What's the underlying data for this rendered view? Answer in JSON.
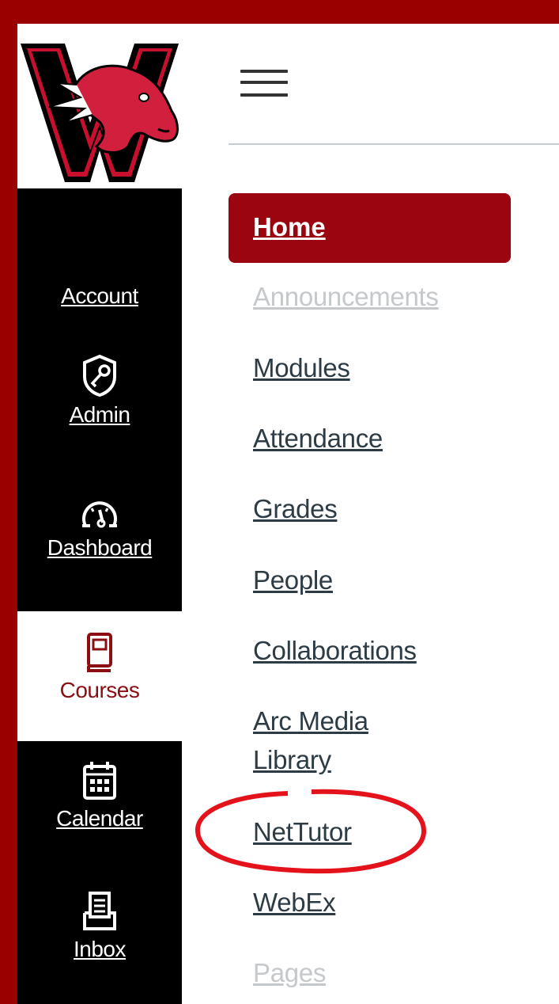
{
  "global_nav": {
    "account": "Account",
    "admin": "Admin",
    "dashboard": "Dashboard",
    "courses": "Courses",
    "calendar": "Calendar",
    "inbox": "Inbox"
  },
  "course_nav": {
    "items": [
      {
        "label": "Home",
        "state": "active"
      },
      {
        "label": "Announcements",
        "state": "disabled"
      },
      {
        "label": "Modules",
        "state": "normal"
      },
      {
        "label": "Attendance",
        "state": "normal"
      },
      {
        "label": "Grades",
        "state": "normal"
      },
      {
        "label": "People",
        "state": "normal"
      },
      {
        "label": "Collaborations",
        "state": "normal"
      },
      {
        "label": "Arc Media",
        "state": "normal"
      },
      {
        "label": "Library",
        "state": "normal"
      },
      {
        "label": "NetTutor",
        "state": "normal"
      },
      {
        "label": "WebEx",
        "state": "normal"
      },
      {
        "label": "Pages",
        "state": "disabled"
      }
    ]
  },
  "colors": {
    "brand_red": "#9b0000",
    "active_course_text": "#8a0e12",
    "nav_bg": "#000000",
    "link_text": "#2d3b45",
    "disabled_text": "#c5c9cc",
    "annotation_red": "#e3121b"
  },
  "icons": {
    "menu": "hamburger-icon",
    "admin": "shield-key-icon",
    "dashboard": "speedometer-icon",
    "courses": "book-icon",
    "calendar": "calendar-icon",
    "inbox": "inbox-icon"
  }
}
